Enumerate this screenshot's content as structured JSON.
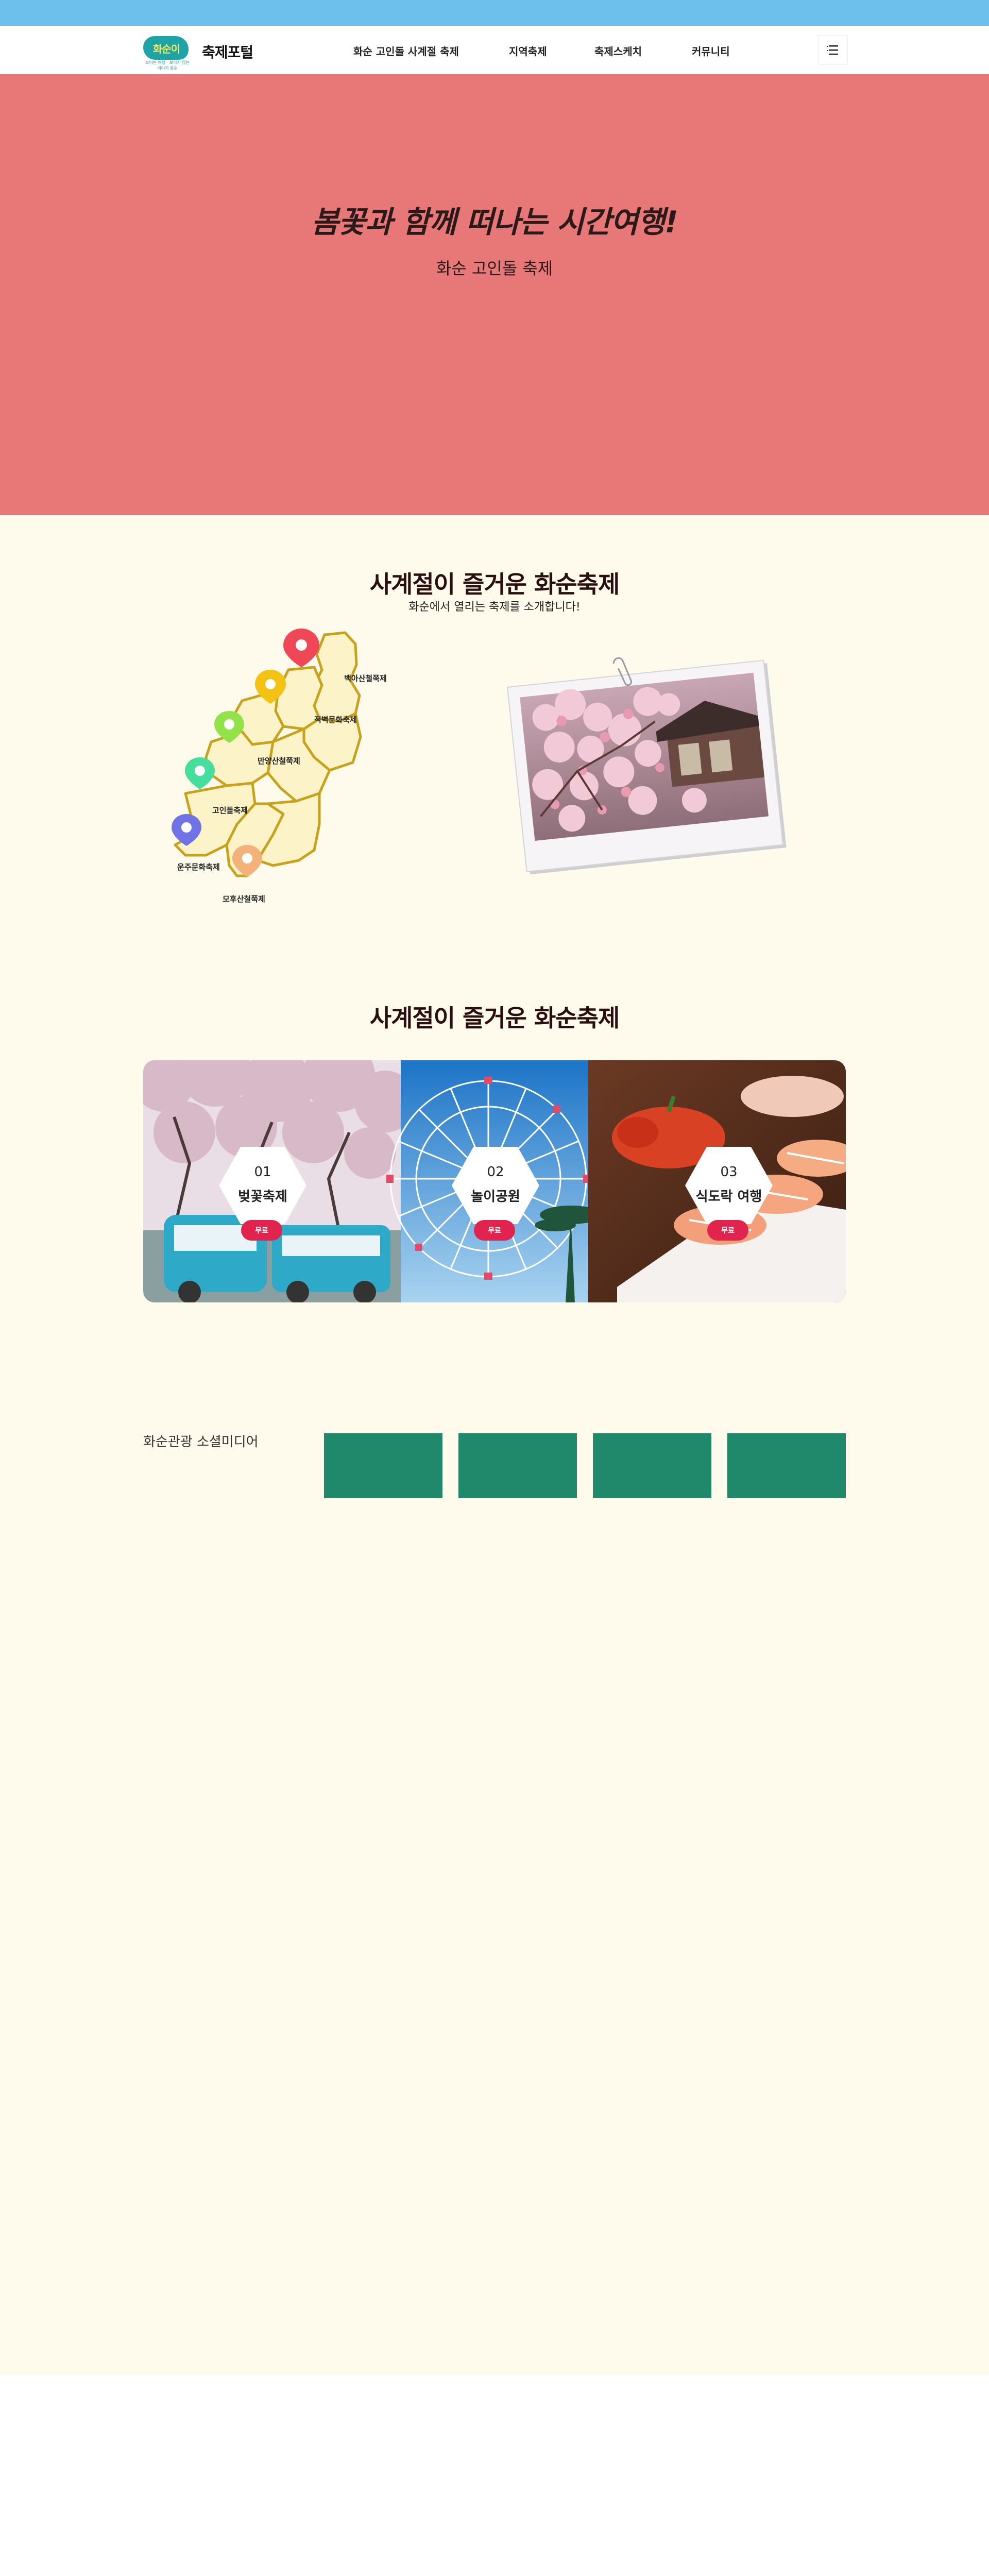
{
  "header": {
    "logo_text": "화순이",
    "logo_sub": "보이는 여행 · 보이지 않는 이야기 화순",
    "site_title": "축제포털",
    "nav": [
      "화순 고인돌 사계절 축제",
      "지역축제",
      "축제스케치",
      "커뮤니티"
    ]
  },
  "hero": {
    "title": "봄꽃과 함께 떠나는 시간여행!",
    "subtitle": "화순 고인돌 축제",
    "bg_color": "#e87877"
  },
  "intro": {
    "title": "사계절이 즐거운 화순축제",
    "subtitle": "화순에서 열리는 축제를 소개합니다!",
    "map_labels": [
      "백아산철쭉제",
      "적벽문화축제",
      "만양산철쭉제",
      "고인돌축제",
      "운주문화축제",
      "모후산철쭉제"
    ]
  },
  "program": {
    "title": "사계절이 즐거운 화순축제",
    "cards": [
      {
        "num": "01",
        "label": "벚꽃축제",
        "badge": "무료"
      },
      {
        "num": "02",
        "label": "놀이공원",
        "badge": "무료"
      },
      {
        "num": "03",
        "label": "식도락 여행",
        "badge": "무료"
      }
    ]
  },
  "social": {
    "label": "화순관광 소셜미디어",
    "tile_color": "#21896b"
  },
  "colors": {
    "topbar": "#6ec0ec",
    "page_bg": "#fefaec",
    "accent": "#e0244e"
  }
}
